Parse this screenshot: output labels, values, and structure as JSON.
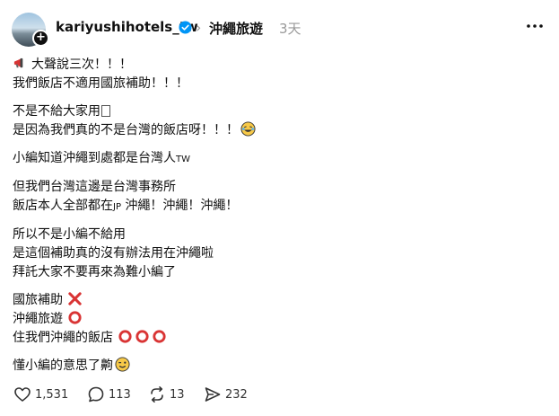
{
  "header": {
    "username": "kariyushihotels_tw",
    "topic": "沖繩旅遊",
    "timestamp": "3天"
  },
  "post": {
    "lines": {
      "l1": "大聲說三次！！！",
      "l2": "我們飯店不適用國旅補助！！！",
      "l3": "不是不給大家用",
      "l4": "是因為我們真的不是台灣的飯店呀！！！",
      "l5a": "小編知道沖繩到處都是台灣人",
      "l5b": "TW",
      "l6": "但我們台灣這邊是台灣事務所",
      "l7a": "飯店本人全部都在",
      "l7b": "JP",
      "l7c": " 沖繩！沖繩！沖繩！",
      "l8": "所以不是小編不給用",
      "l9": "是這個補助真的沒有辦法用在沖繩啦",
      "l10": "拜託大家不要再來為難小編了",
      "l11": "國旅補助",
      "l12": "沖繩旅遊",
      "l13": "住我們沖繩的飯店",
      "l14": "懂小編的意思了齁"
    }
  },
  "actions": {
    "likes": "1,531",
    "comments": "113",
    "reposts": "13",
    "shares": "232"
  },
  "colors": {
    "cross": "#d93434",
    "circle": "#d93434",
    "verified": "#0095f6",
    "muted": "#999999"
  }
}
